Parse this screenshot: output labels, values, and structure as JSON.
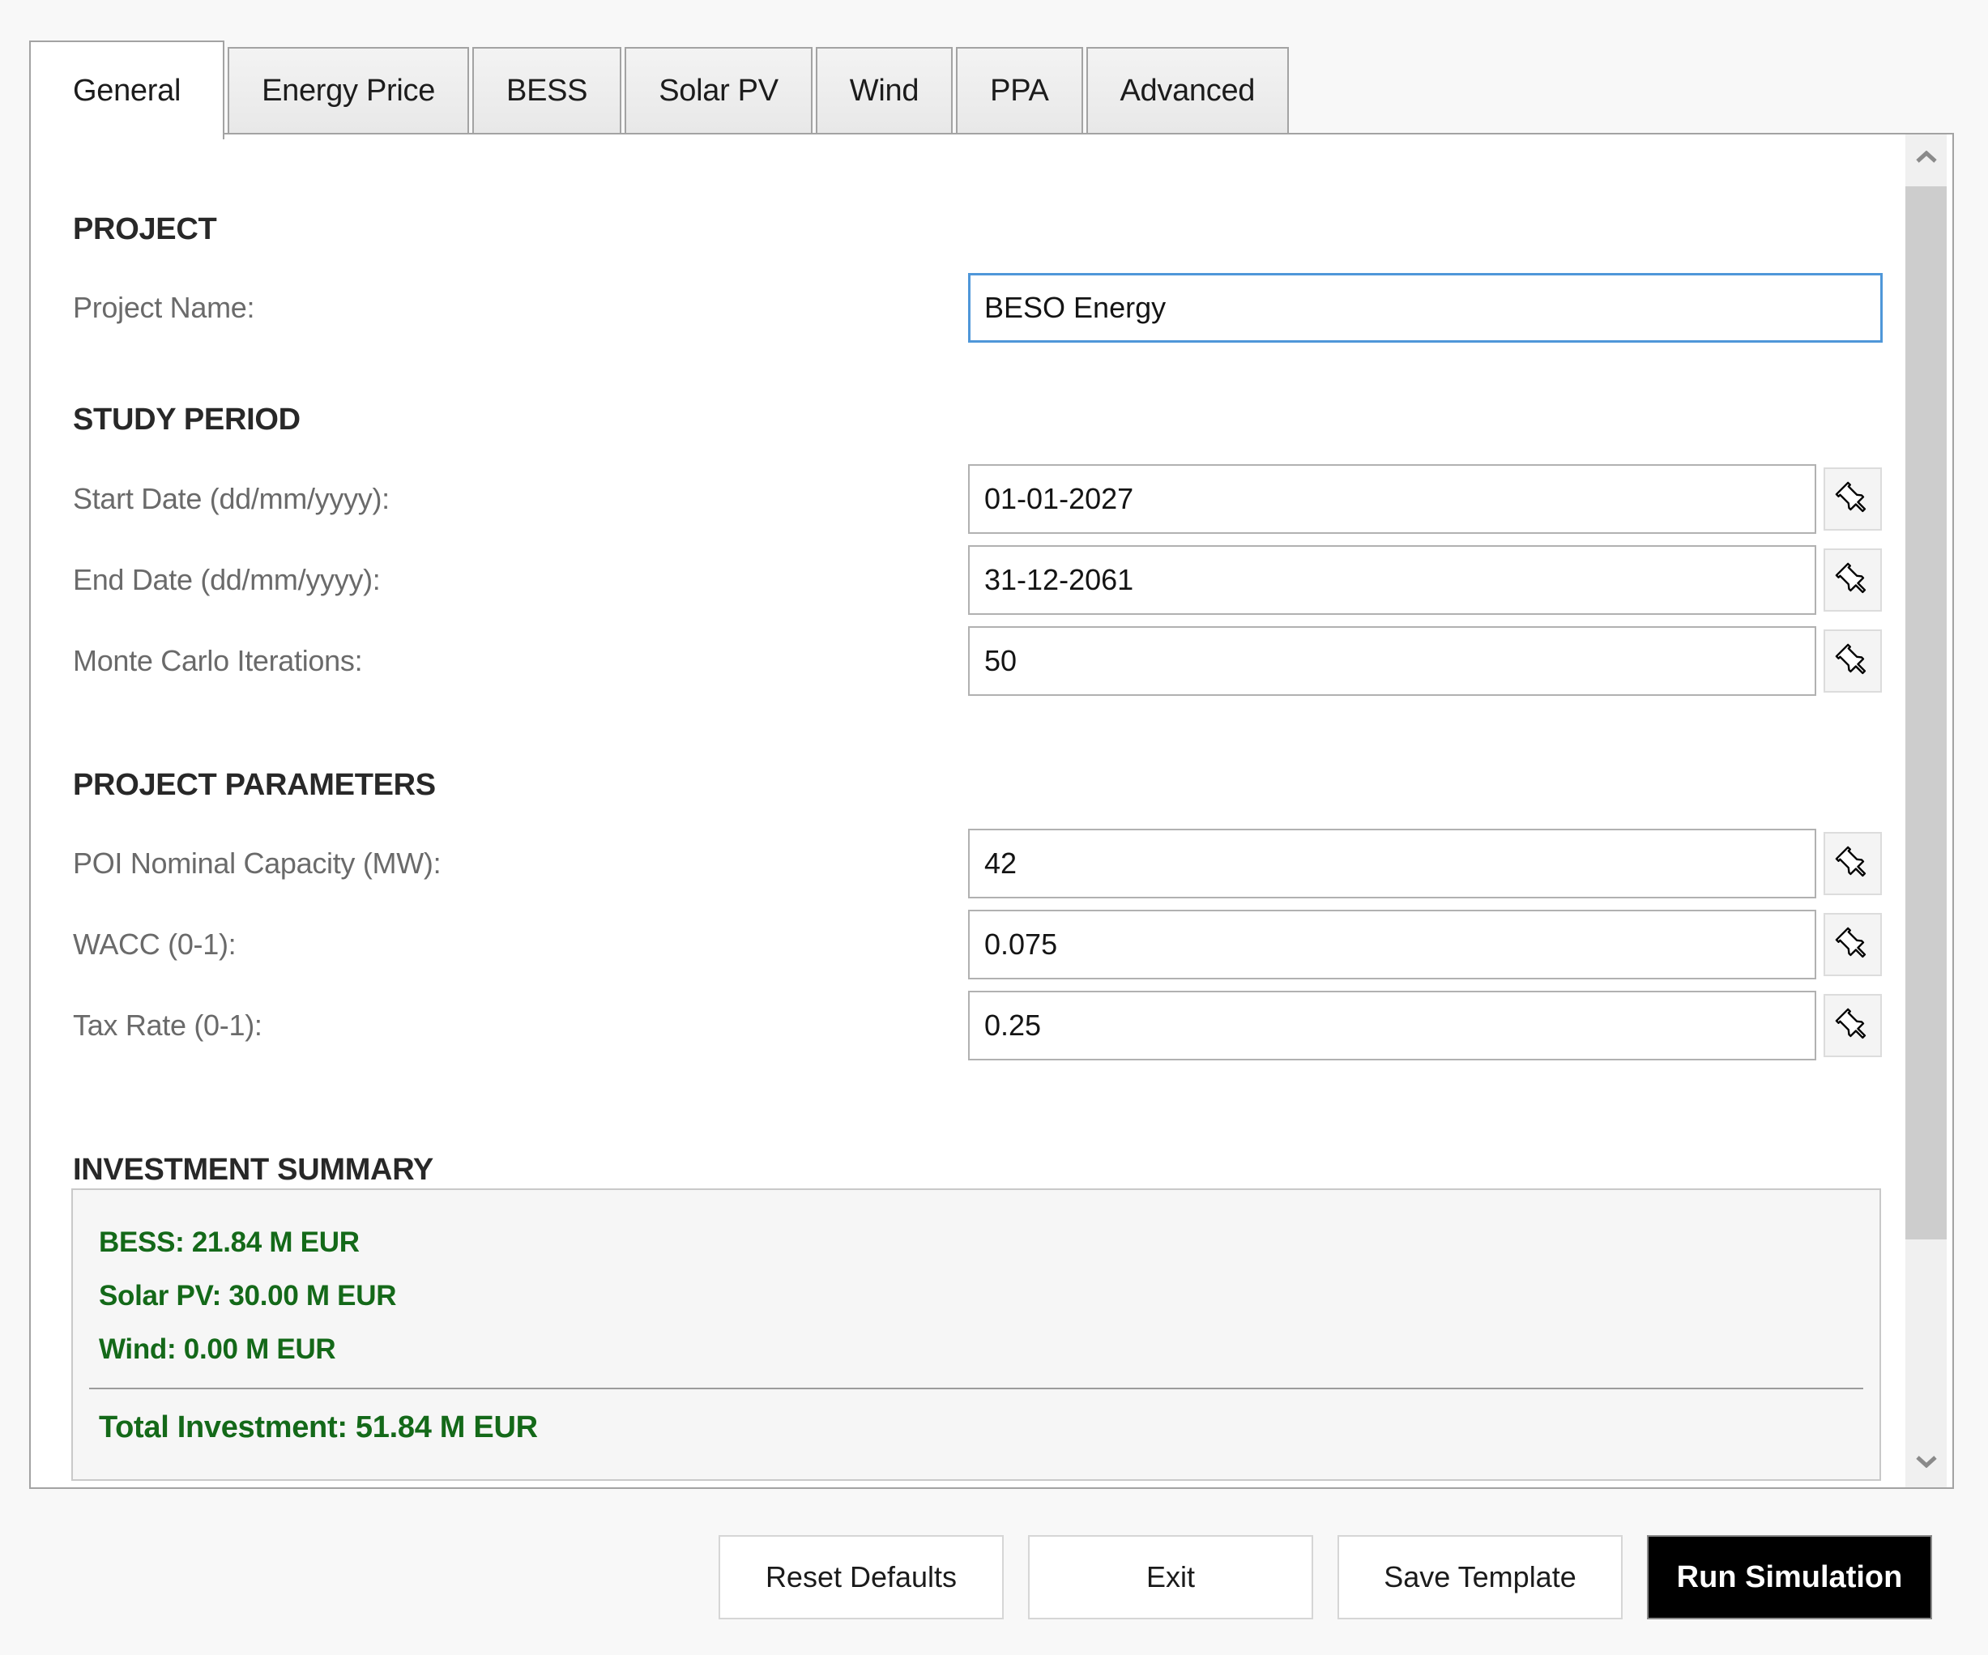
{
  "tabs": [
    {
      "label": "General",
      "active": true
    },
    {
      "label": "Energy Price",
      "active": false
    },
    {
      "label": "BESS",
      "active": false
    },
    {
      "label": "Solar PV",
      "active": false
    },
    {
      "label": "Wind",
      "active": false
    },
    {
      "label": "PPA",
      "active": false
    },
    {
      "label": "Advanced",
      "active": false
    }
  ],
  "sections": {
    "project": {
      "title": "PROJECT",
      "fields": [
        {
          "label": "Project Name:",
          "value": "BESO Energy",
          "focused": true
        }
      ]
    },
    "study_period": {
      "title": "STUDY PERIOD",
      "fields": [
        {
          "label": "Start Date (dd/mm/yyyy):",
          "value": "01-01-2027",
          "pinned": true
        },
        {
          "label": "End Date (dd/mm/yyyy):",
          "value": "31-12-2061",
          "pinned": true
        },
        {
          "label": "Monte Carlo Iterations:",
          "value": "50",
          "pinned": true
        }
      ]
    },
    "project_parameters": {
      "title": "PROJECT PARAMETERS",
      "fields": [
        {
          "label": "POI Nominal Capacity (MW):",
          "value": "42",
          "pinned": true
        },
        {
          "label": "WACC (0-1):",
          "value": "0.075",
          "pinned": true
        },
        {
          "label": "Tax Rate (0-1):",
          "value": "0.25",
          "pinned": true
        }
      ]
    },
    "investment_summary": {
      "title": "INVESTMENT SUMMARY",
      "lines": [
        "BESS: 21.84 M EUR",
        "Solar PV: 30.00 M EUR",
        "Wind: 0.00 M EUR"
      ],
      "total": "Total Investment: 51.84 M EUR"
    }
  },
  "footer_buttons": [
    {
      "label": "Reset Defaults",
      "primary": false
    },
    {
      "label": "Exit",
      "primary": false
    },
    {
      "label": "Save Template",
      "primary": false
    },
    {
      "label": "Run Simulation",
      "primary": true
    }
  ],
  "icons": {
    "pin": "pushpin-icon",
    "scroll_up": "chevron-up-icon",
    "scroll_down": "chevron-down-icon"
  },
  "colors": {
    "accent_green": "#146919",
    "focus_blue": "#4f97d9",
    "primary_button_bg": "#000000"
  }
}
